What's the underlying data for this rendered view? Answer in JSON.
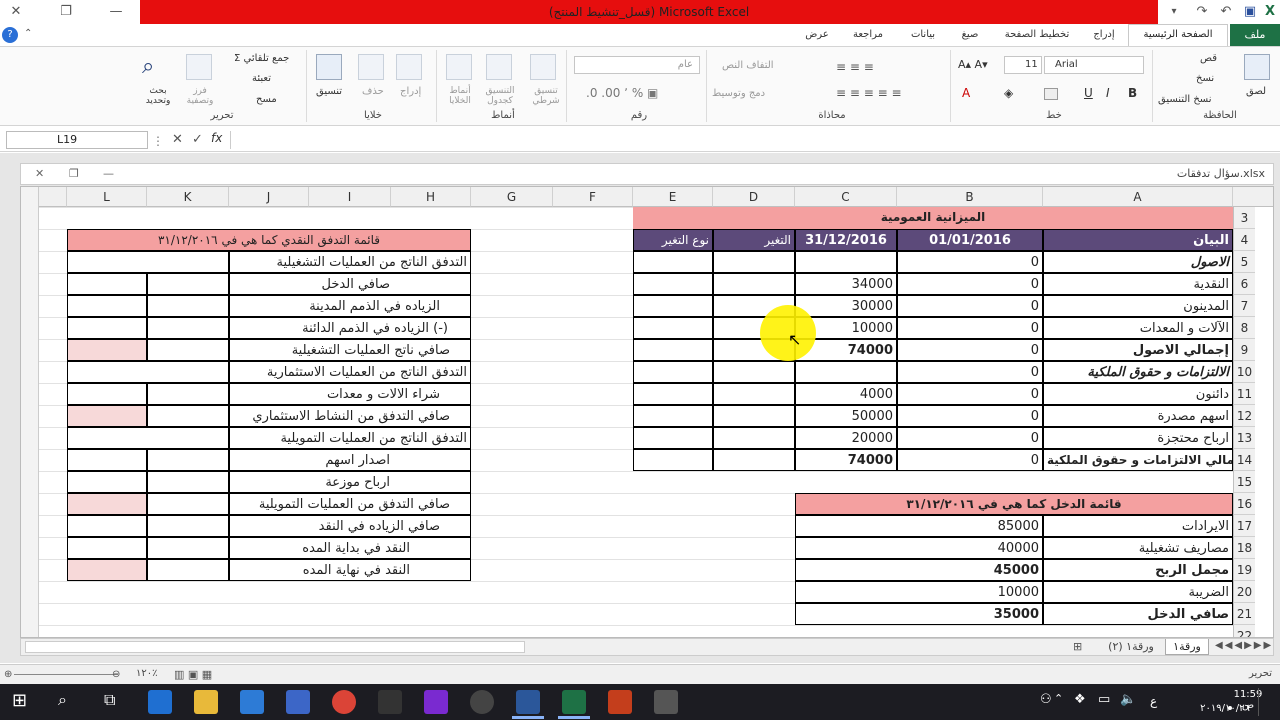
{
  "window": {
    "title": "(قسل_تنشيط المنتج) Microsoft Excel"
  },
  "tabs": [
    {
      "label": "ملف"
    },
    {
      "label": "الصفحة الرئيسية"
    },
    {
      "label": "إدراج"
    },
    {
      "label": "تخطيط الصفحة"
    },
    {
      "label": "صيغ"
    },
    {
      "label": "بيانات"
    },
    {
      "label": "مراجعة"
    },
    {
      "label": "عرض"
    }
  ],
  "ribbon": {
    "clipboard": {
      "label": "الحافظة",
      "paste": "لصق",
      "cut": "قص",
      "copy": "نسخ",
      "format_painter": "نسخ التنسيق"
    },
    "font": {
      "label": "خط",
      "name": "Arial",
      "size": "11"
    },
    "alignment": {
      "label": "محاذاة",
      "wrap": "التفاف النص",
      "merge": "دمج وتوسيط"
    },
    "number": {
      "label": "رقم",
      "format": "عام"
    },
    "styles": {
      "label": "أنماط",
      "conditional": "تنسيق شرطي",
      "as_table": "التنسيق كجدول",
      "cell_styles": "أنماط الخلايا"
    },
    "cells": {
      "label": "خلايا",
      "insert": "إدراج",
      "delete": "حذف",
      "format": "تنسيق"
    },
    "editing": {
      "label": "تحرير",
      "autosum": "جمع تلقائي",
      "fill": "تعبئة",
      "clear": "مسح",
      "sort": "فرز وتصفية",
      "find": "بحث وتحديد"
    }
  },
  "formula_bar": {
    "name_box": "L19",
    "fx": "fx",
    "value": ""
  },
  "workbook": {
    "title": "سؤال تدفقات.xlsx"
  },
  "columns": [
    "L",
    "K",
    "J",
    "I",
    "H",
    "G",
    "F",
    "E",
    "D",
    "C",
    "B",
    "A"
  ],
  "rows": [
    "3",
    "4",
    "5",
    "6",
    "7",
    "8",
    "9",
    "10",
    "11",
    "12",
    "13",
    "14",
    "15",
    "16",
    "17",
    "18",
    "19",
    "20",
    "21",
    "22"
  ],
  "balance_sheet": {
    "title": "الميزانية العمومية",
    "headers": {
      "item": "البيان",
      "d1": "01/01/2016",
      "d2": "31/12/2016",
      "change": "التغير",
      "change_type": "نوع التغير"
    },
    "rows": [
      {
        "item": "الاصول",
        "b": "0",
        "c": ""
      },
      {
        "item": "النقدية",
        "b": "0",
        "c": "34000"
      },
      {
        "item": "المدينون",
        "b": "0",
        "c": "30000"
      },
      {
        "item": "الآلات و المعدات",
        "b": "0",
        "c": "10000"
      },
      {
        "item": "إجمالي الاصول",
        "b": "0",
        "c": "74000"
      },
      {
        "item": "الالتزامات و حقوق الملكية",
        "b": "0",
        "c": ""
      },
      {
        "item": "دائنون",
        "b": "0",
        "c": "4000"
      },
      {
        "item": "اسهم مصدرة",
        "b": "0",
        "c": "50000"
      },
      {
        "item": "ارباح محتجزة",
        "b": "0",
        "c": "20000"
      },
      {
        "item": "اجمالي الالتزامات و حقوق الملكية",
        "b": "0",
        "c": "74000"
      }
    ]
  },
  "income_statement": {
    "title": "قائمة الدخل كما هي في ٣١/١٢/٢٠١٦",
    "rows": [
      {
        "item": "الايرادات",
        "value": "85000"
      },
      {
        "item": "مصاريف تشغيلية",
        "value": "40000"
      },
      {
        "item": "مجمل الربح",
        "value": "45000"
      },
      {
        "item": "الضريبة",
        "value": "10000"
      },
      {
        "item": "صافي الدخل",
        "value": "35000"
      }
    ]
  },
  "cash_flow": {
    "title": "قائمة التدفق النقدي كما هي في ٣١/١٢/٢٠١٦",
    "rows": [
      "التدفق الناتج من العمليات التشغيلية",
      "صافي الدخل",
      "الزياده في الذمم المدينة",
      "الزياده في الذمم الدائنة (-)",
      "صافي ناتج العمليات التشغيلية",
      "التدفق الناتج من العمليات الاستثمارية",
      "شراء الالات و معدات",
      "صافي التدفق من النشاط الاستثماري",
      "التدفق الناتج من العمليات التمويلية",
      "اصدار اسهم",
      "ارباح موزعة",
      "صافي التدفق من العمليات التمويلية",
      "صافي الزياده في النقد",
      "النقد في بداية المده",
      "النقد في نهاية المده"
    ]
  },
  "sheets": [
    "ورقة١",
    "ورقة١ (٢)"
  ],
  "status": {
    "mode": "تحرير",
    "zoom": "١٢٠٪"
  },
  "taskbar": {
    "time": "11:59 ص",
    "date": "٢٠١٩/١٠/٢٦",
    "lang": "ع"
  }
}
